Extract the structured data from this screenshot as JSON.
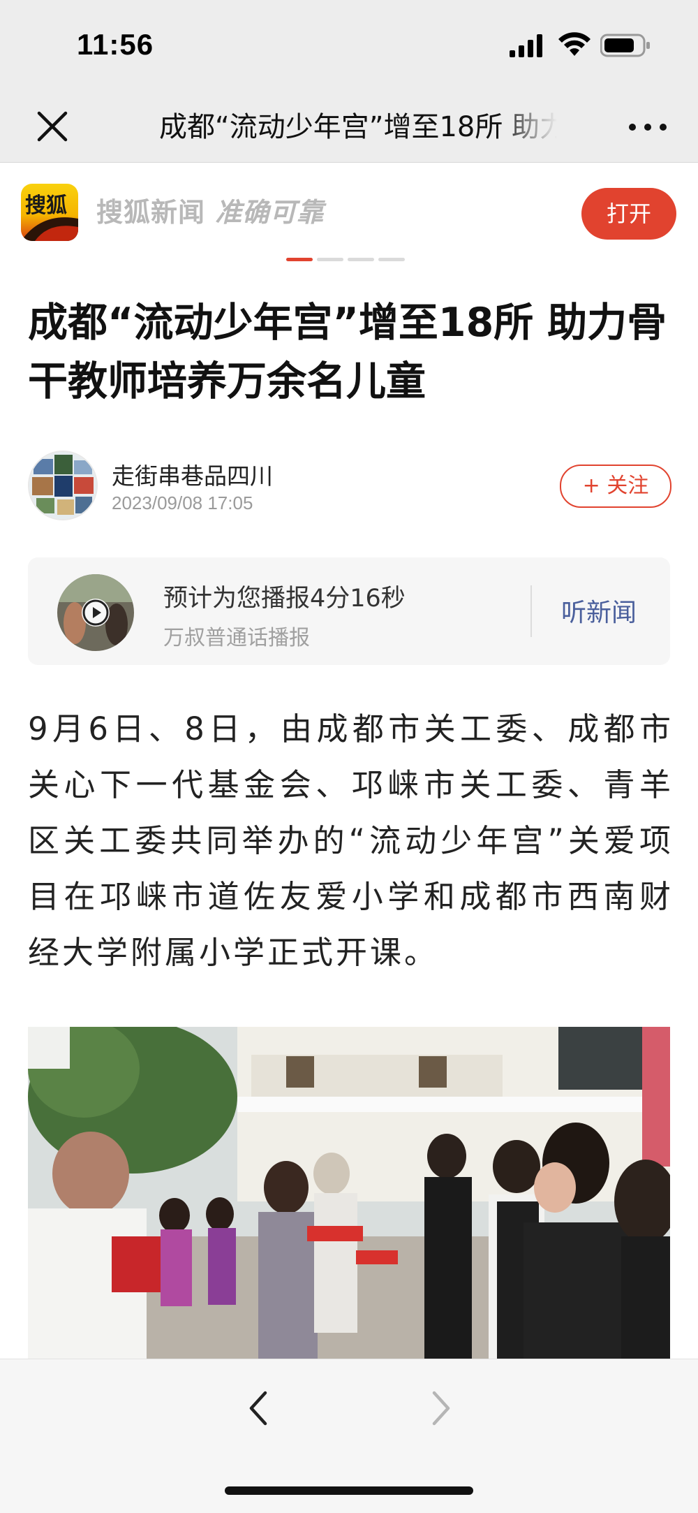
{
  "status_bar": {
    "time": "11:56"
  },
  "nav": {
    "title": "成都“流动少年宫”增至18所 助力骨干教师培养万余名儿童"
  },
  "banner": {
    "logo_text": "搜狐",
    "app_name": "搜狐新闻",
    "slogan": "准确可靠",
    "open_label": "打开",
    "carousel_total": 4,
    "carousel_active": 1
  },
  "article": {
    "headline": "成都“流动少年宫”增至18所 助力骨干教师培养万余名儿童",
    "author": {
      "name": "走街串巷品四川",
      "date": "2023/09/08 17:05",
      "follow_label": "+ 关注"
    },
    "audio": {
      "title": "预计为您播报4分16秒",
      "voice": "万叔普通话播报",
      "listen_label": "听新闻"
    },
    "paragraph": "9月6日、8日，由成都市关工委、成都市关心下一代基金会、邛崃市关工委、青羊区关工委共同举办的“流动少年宫”关爱项目在邛崃市道佐友爱小学和成都市西南财经大学附属小学正式开课。"
  },
  "colors": {
    "accent": "#e1432f",
    "link": "#4a5f9c"
  },
  "icons": [
    "close-icon",
    "more-icon",
    "play-icon",
    "back-icon",
    "forward-icon"
  ]
}
